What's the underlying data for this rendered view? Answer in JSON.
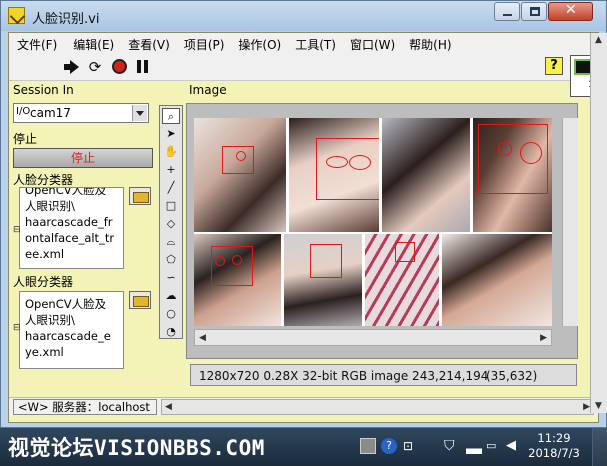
{
  "window": {
    "title": "人脸识别.vi"
  },
  "menu": [
    "文件(F)",
    "编辑(E)",
    "查看(V)",
    "项目(P)",
    "操作(O)",
    "工具(T)",
    "窗口(W)",
    "帮助(H)"
  ],
  "toolbar": {
    "help_label": "?",
    "vi_icon_number": "1"
  },
  "session": {
    "label": "Session In",
    "io_icon": "I/O",
    "value": "cam17"
  },
  "stop": {
    "label": "停止",
    "button_label": "停止"
  },
  "face_classifier": {
    "label": "人脸分类器",
    "lines": [
      "OpenCV人脸及",
      "人眼识别\\",
      "haarcascade_fr",
      "ontalface_alt_tr",
      "ee.xml"
    ]
  },
  "eye_classifier": {
    "label": "人眼分类器",
    "lines": [
      "OpenCV人脸及",
      "人眼识别\\",
      "haarcascade_e",
      "ye.xml"
    ]
  },
  "image": {
    "label": "Image",
    "info_text": "1280x720 0.28X 32-bit RGB image 243,214,194",
    "coords": "(35,632)"
  },
  "status": {
    "server": "<W> 服务器：localhost"
  },
  "taskbar": {
    "watermark": "视觉论坛VISIONBBS.COM",
    "time": "11:29",
    "date": "2018/7/3"
  },
  "colors": {
    "detection_box": "#e01818",
    "panel_bg": "#f3f3b8",
    "stop_text": "#e02020"
  },
  "icons": [
    "app-icon",
    "run-arrow-icon",
    "run-continuous-icon",
    "abort-icon",
    "pause-icon",
    "help-icon",
    "folder-icon",
    "zoom-icon",
    "arrow-pointer-icon",
    "hand-pan-icon",
    "crosshair-icon",
    "line-icon",
    "rectangle-icon",
    "rotated-rectangle-icon",
    "polygon-icon",
    "freehand-icon",
    "oval-icon",
    "annulus-icon"
  ]
}
